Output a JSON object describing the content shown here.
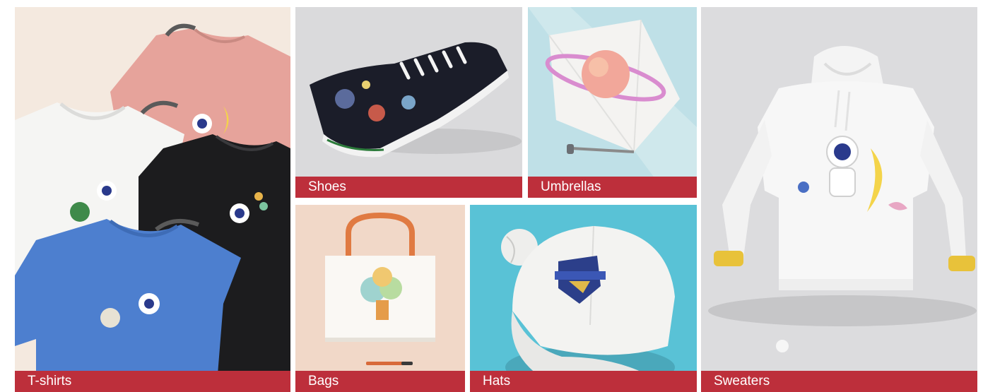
{
  "gallery": {
    "tiles": [
      {
        "label": "T-shirts"
      },
      {
        "label": "Shoes"
      },
      {
        "label": "Umbrellas"
      },
      {
        "label": "Bags"
      },
      {
        "label": "Hats"
      },
      {
        "label": "Sweaters"
      }
    ]
  },
  "colors": {
    "label_bar": "#bd2f3b",
    "label_text": "#ffffff"
  }
}
